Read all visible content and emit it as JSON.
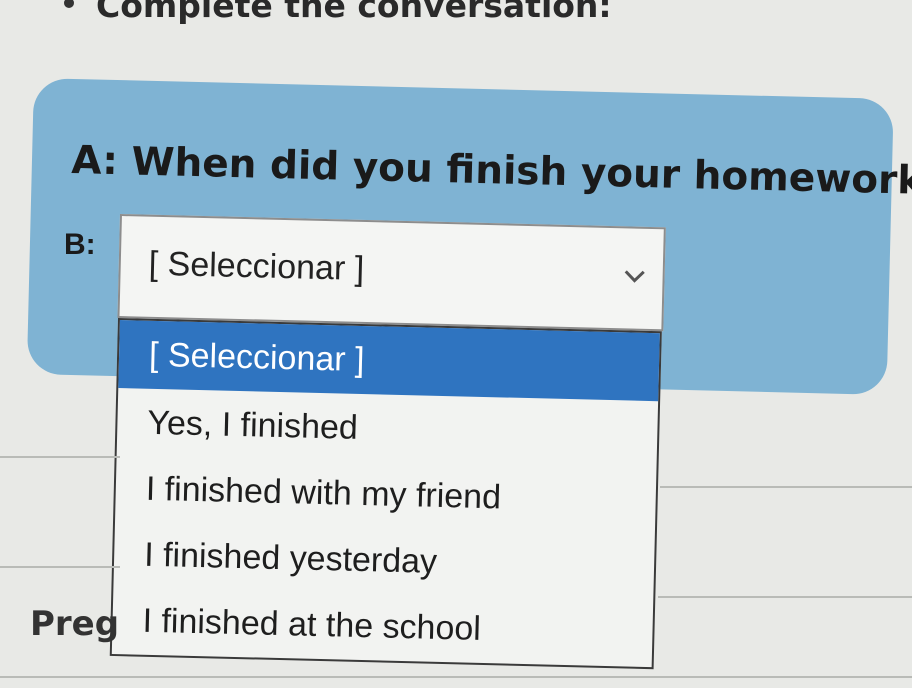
{
  "instruction": "Complete the conversation:",
  "question": {
    "speaker": "A:",
    "text": "When did you finish your homework?"
  },
  "answer": {
    "speaker": "B:",
    "select": {
      "value": "[ Seleccionar ]",
      "options": [
        "[ Seleccionar ]",
        "Yes, I finished",
        "I finished with my friend",
        "I finished yesterday",
        "I finished at the school"
      ],
      "highlighted_index": 0
    }
  },
  "partial_text": "Preg",
  "colors": {
    "panel": "#7fb3d3",
    "highlight": "#2f74c0",
    "background": "#e8e9e6"
  },
  "icons": {
    "dropdown_arrow": "chevron-down-icon"
  }
}
